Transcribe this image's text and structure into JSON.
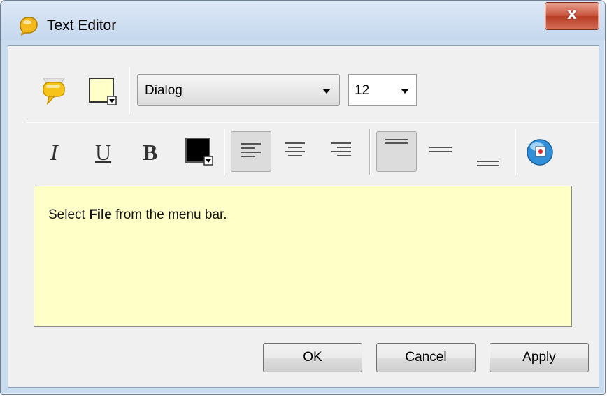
{
  "window": {
    "title": "Text Editor",
    "close_label": "x"
  },
  "toolbar": {
    "font_name": "Dialog",
    "font_size": "12",
    "italic_label": "I",
    "underline_label": "U",
    "bold_label": "B",
    "icons": [
      "callout-icon",
      "background-color-icon",
      "text-color-icon",
      "align-left-icon",
      "align-center-icon",
      "align-right-icon",
      "valign-top-icon",
      "valign-middle-icon",
      "valign-bottom-icon",
      "insert-image-icon"
    ],
    "active_align": "left",
    "active_valign": "top"
  },
  "editor": {
    "text_before": "Select ",
    "text_bold": "File",
    "text_after": " from the  menu bar."
  },
  "buttons": {
    "ok": "OK",
    "cancel": "Cancel",
    "apply": "Apply"
  },
  "colors": {
    "editor_background": "#ffffc8",
    "background_swatch": "#ffffc8",
    "text_color_swatch": "#000000",
    "close_button": "#c8533b"
  }
}
